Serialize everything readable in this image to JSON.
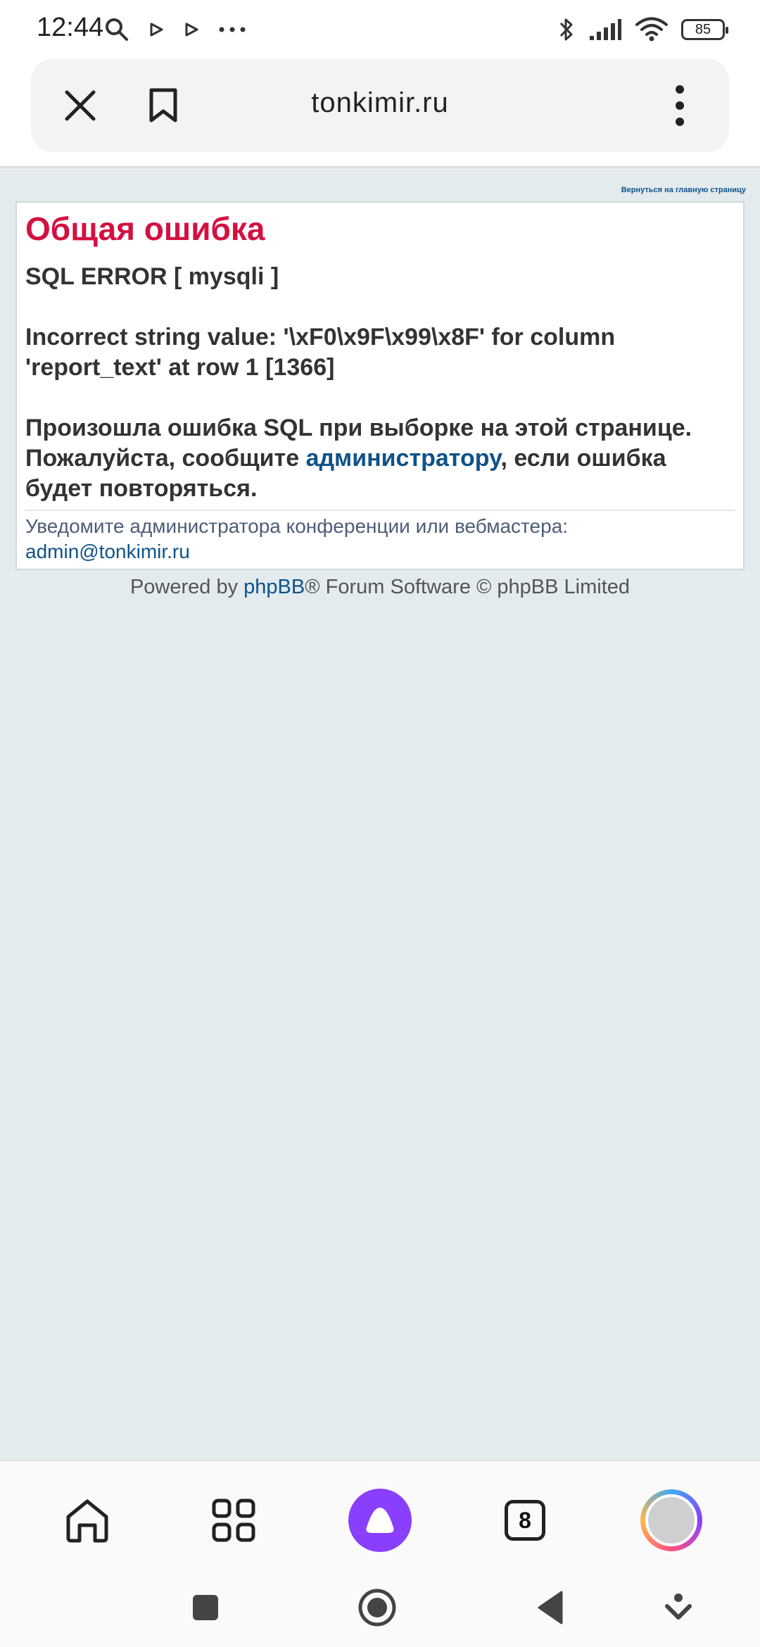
{
  "status_bar": {
    "time": "12:44",
    "battery": "85",
    "icons": [
      "search-icon",
      "play-icon",
      "play-icon",
      "more-dots-icon",
      "bluetooth-icon",
      "signal-icon",
      "wifi-icon",
      "battery-icon"
    ]
  },
  "browser": {
    "url": "tonkimir.ru",
    "tabs_count": "8"
  },
  "page": {
    "back_link": "Вернуться на главную страницу",
    "title": "Общая ошибка",
    "error_type": "SQL ERROR [ mysqli ]",
    "error_message": "Incorrect string value: '\\xF0\\x9F\\x99\\x8F' for column 'report_text' at row 1 [1366]",
    "message_before_link": "Произошла ошибка SQL при выборке на этой странице. Пожалуйста, сообщите ",
    "admin_link": "администратору",
    "message_after_link": ", если ошибка будет повторяться.",
    "notify_text": "Уведомите администратора конференции или вебмастера:",
    "admin_email": "admin@tonkimir.ru",
    "powered_prefix": "Powered by ",
    "powered_link": "phpBB",
    "powered_suffix": "® Forum Software © phpBB Limited"
  },
  "colors": {
    "title": "#d31141",
    "link": "#105289",
    "page_bg": "#e3ebee",
    "alice": "#8a3ffc"
  }
}
